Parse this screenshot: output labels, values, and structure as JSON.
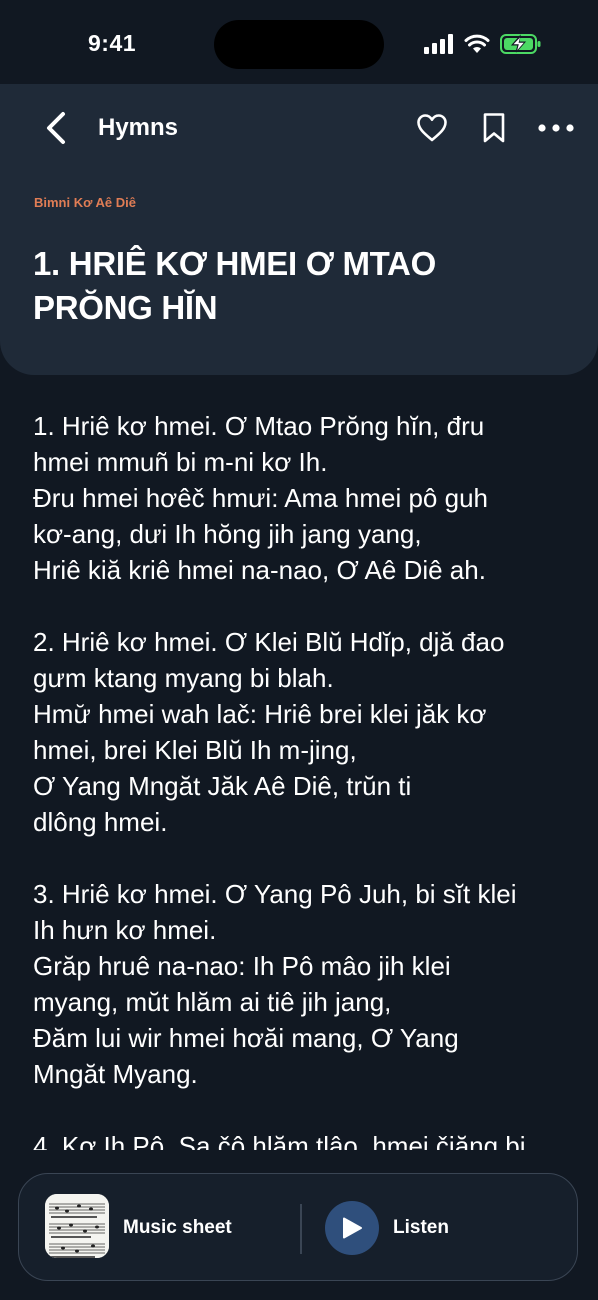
{
  "status_bar": {
    "time": "9:41",
    "icons": [
      "cellular-signal-icon",
      "wifi-icon",
      "battery-charging-icon"
    ],
    "battery_color": "#4cd964"
  },
  "nav": {
    "title": "Hymns",
    "icons": [
      "back-chevron-icon",
      "heart-icon",
      "bookmark-icon",
      "more-options-icon"
    ]
  },
  "hymn": {
    "category": "Bimni Kơ Aê Diê",
    "title": "1. HRIÊ KƠ HMEI Ơ MTAO PRŎNG HĬN",
    "verses": [
      "1. Hriê kơ hmei. Ơ Mtao Prŏng hĭn, đru\nhmei mmuñ bi m-ni kơ Ih.\nĐru hmei hơêč hmưi: Ama hmei pô guh\nkơ-ang, dưi Ih hŏng jih jang yang,\nHriê kiă kriê hmei na-nao, Ơ Aê Diê ah.",
      "2. Hriê kơ hmei. Ơ Klei Blŭ Hdĭp, djă đao\ngưm ktang myang bi blah.\nHmư̆ hmei wah lač: Hriê brei klei jăk kơ\nhmei, brei Klei Blŭ Ih m-jing,\nƠ Yang Mngăt Jăk Aê Diê, trŭn ti\ndlông hmei.",
      "3. Hriê kơ hmei. Ơ Yang Pô Juh, bi sĭt klei\nIh hưn kơ hmei.\nGrăp hruê na-nao: Ih Pô mâo jih klei\nmyang, mŭt hlăm ai tiê jih jang,\nĐăm lui wir hmei hơăi mang, Ơ Yang\nMngăt Myang.",
      "4. Kơ Ih Pô. Sa čô hlăm tlâo, hmei čiăng bi"
    ]
  },
  "player": {
    "sheet_label": "Music sheet",
    "listen_label": "Listen",
    "accent_color": "#2f4f7c"
  },
  "colors": {
    "background": "#111822",
    "card": "#1f2a38",
    "category": "#e07d55"
  }
}
